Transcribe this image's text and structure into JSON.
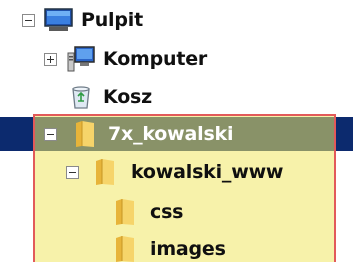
{
  "tree": {
    "desktop": {
      "label": "Pulpit",
      "expander": "minus",
      "icon": "desktop-icon"
    },
    "computer": {
      "label": "Komputer",
      "expander": "plus",
      "icon": "computer-icon"
    },
    "recycle_bin": {
      "label": "Kosz",
      "icon": "recycle-bin-icon"
    },
    "user_folder": {
      "label": "7x_kowalski",
      "expander": "minus",
      "icon": "folder-icon",
      "selected": true
    },
    "www_folder": {
      "label": "kowalski_www",
      "expander": "minus",
      "icon": "folder-icon"
    },
    "css_folder": {
      "label": "css",
      "icon": "folder-icon"
    },
    "images_folder": {
      "label": "images",
      "icon": "folder-icon"
    }
  },
  "colors": {
    "selection": "#0c2a6e",
    "highlight_fill": "#f0e864",
    "highlight_border": "#e25a5a",
    "folder": "#f2c94c"
  }
}
